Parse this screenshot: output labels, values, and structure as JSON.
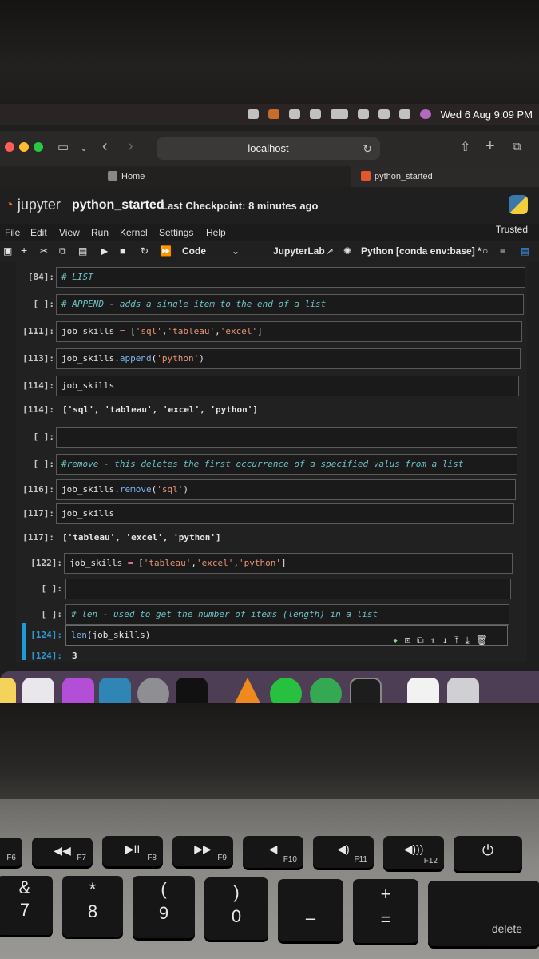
{
  "menubar": {
    "clock": "Wed 6 Aug  9:09 PM"
  },
  "browser": {
    "url": "localhost",
    "tabs": [
      {
        "label": "Home"
      },
      {
        "label": "python_started"
      }
    ]
  },
  "jupyter": {
    "logo_text": "jupyter",
    "notebook_title": "python_started",
    "checkpoint": "Last Checkpoint: 8 minutes ago",
    "menu": [
      "File",
      "Edit",
      "View",
      "Run",
      "Kernel",
      "Settings",
      "Help"
    ],
    "trusted": "Trusted",
    "toolbar": {
      "cell_type": "Code",
      "jupyterlab_link": "JupyterLab",
      "kernel": "Python [conda env:base] *"
    }
  },
  "cells": [
    {
      "prompt": "[84]:",
      "source": "# LIST"
    },
    {
      "prompt": "[ ]:",
      "source": "# APPEND - adds a single item to the end of a list"
    },
    {
      "prompt": "[111]:",
      "source_parts": [
        "job_skills",
        " = ",
        "[",
        "'sql'",
        ",",
        "'tableau'",
        ",",
        "'excel'",
        "]"
      ]
    },
    {
      "prompt": "[113]:",
      "source_parts": [
        "job_skills.",
        "append",
        "(",
        "'python'",
        ")"
      ]
    },
    {
      "prompt": "[114]:",
      "source": "job_skills",
      "out_prompt": "[114]:",
      "output": "['sql', 'tableau', 'excel', 'python']"
    },
    {
      "prompt": "[ ]:",
      "source": ""
    },
    {
      "prompt": "[ ]:",
      "source": "#remove - this deletes the first occurrence of a specified valus from a list"
    },
    {
      "prompt": "[116]:",
      "source_parts": [
        "job_skills.",
        "remove",
        "(",
        "'sql'",
        ")"
      ]
    },
    {
      "prompt": "[117]:",
      "source": "job_skills",
      "out_prompt": "[117]:",
      "output": "['tableau', 'excel', 'python']"
    },
    {
      "prompt": "[122]:",
      "source_parts": [
        "job_skills",
        " = ",
        "[",
        "'tableau'",
        ",",
        "'excel'",
        ",",
        "'python'",
        "]"
      ]
    },
    {
      "prompt": "[ ]:",
      "source": ""
    },
    {
      "prompt": "[ ]:",
      "source": "# len - used to get the number of items (length) in a list"
    },
    {
      "prompt": "[124]:",
      "source_parts": [
        "len",
        "(job_skills)"
      ],
      "out_prompt": "[124]:",
      "output": "3"
    }
  ],
  "keyboard": {
    "fn_keys": [
      "F6",
      "F7",
      "F8",
      "F9",
      "F10",
      "F11",
      "F12"
    ],
    "number_keys": [
      {
        "top": "&",
        "bottom": "7"
      },
      {
        "top": "*",
        "bottom": "8"
      },
      {
        "top": "(",
        "bottom": "9"
      },
      {
        "top": ")",
        "bottom": "0"
      },
      {
        "top": "",
        "bottom": "–"
      },
      {
        "top": "+",
        "bottom": "="
      }
    ],
    "delete_label": "delete"
  },
  "colors": {
    "jupyter_orange": "#f37726",
    "active_cell_blue": "#1e9bd7",
    "string": "#e99474",
    "comment": "#6fc3c8"
  }
}
